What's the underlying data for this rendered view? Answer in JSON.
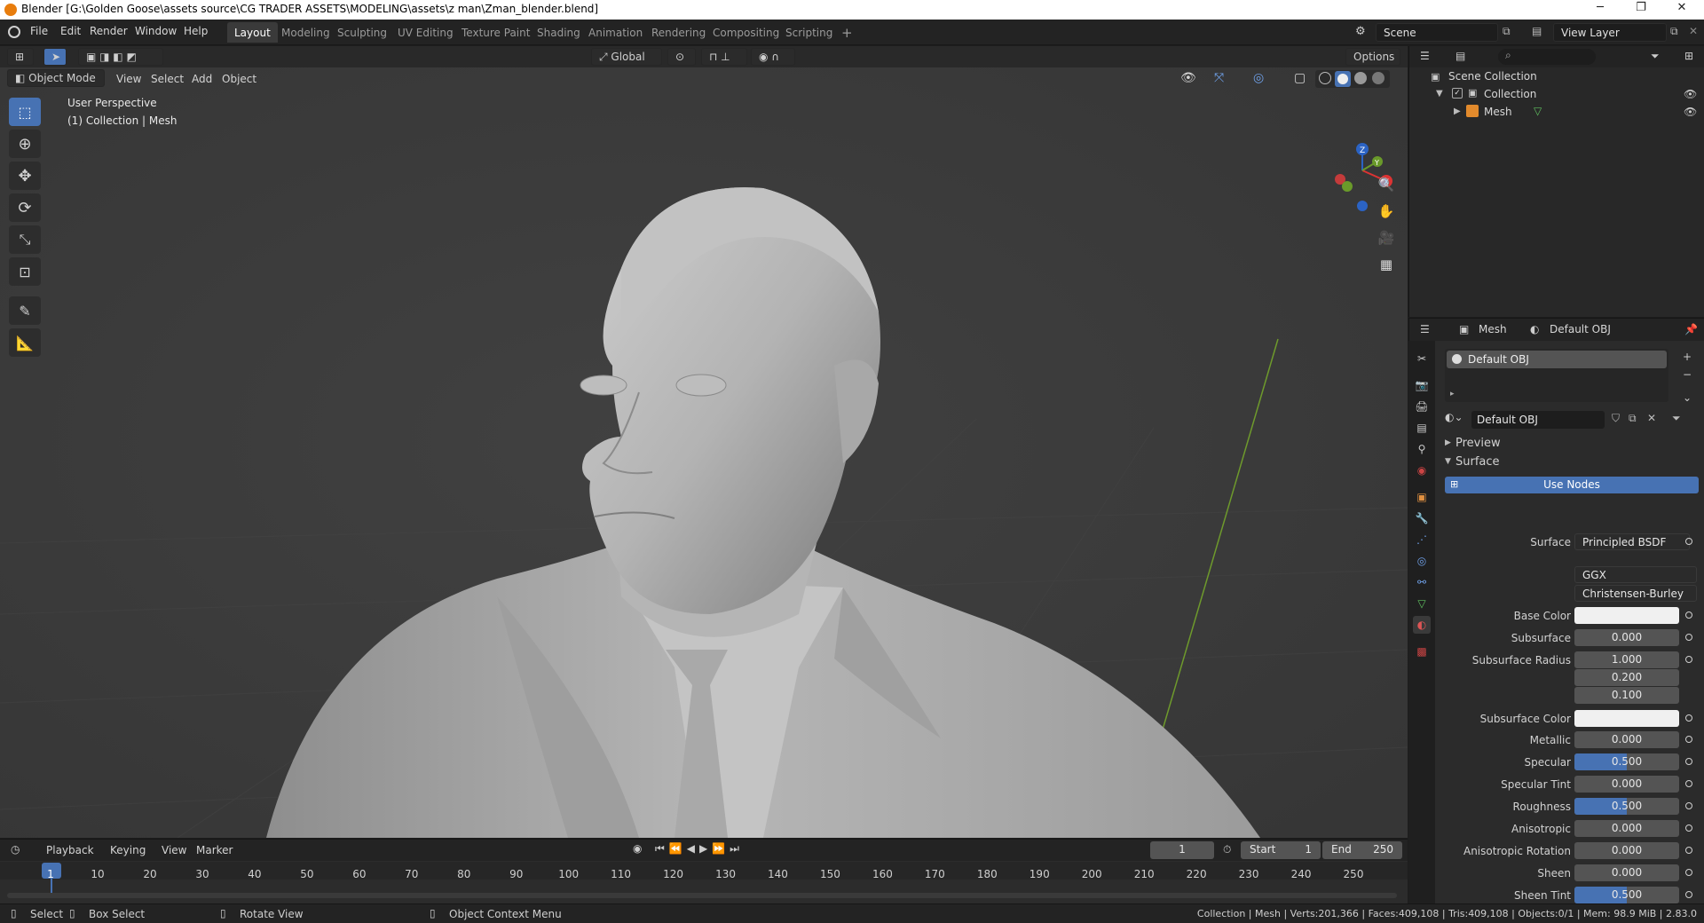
{
  "window": {
    "title": "Blender [G:\\Golden Goose\\assets source\\CG TRADER ASSETS\\MODELING\\assets\\z man\\Zman_blender.blend]",
    "controls": [
      "─",
      "❐",
      "✕"
    ]
  },
  "menu": [
    "File",
    "Edit",
    "Render",
    "Window",
    "Help"
  ],
  "workspaces": [
    "Layout",
    "Modeling",
    "Sculpting",
    "UV Editing",
    "Texture Paint",
    "Shading",
    "Animation",
    "Rendering",
    "Compositing",
    "Scripting"
  ],
  "workspace_add": "+",
  "active_workspace": "Layout",
  "scene": {
    "name": "Scene",
    "view_layer": "View Layer"
  },
  "toolbar_header": {
    "orientation": "Global",
    "options": "Options"
  },
  "viewport_header": {
    "mode": "Object Mode",
    "menus": [
      "View",
      "Select",
      "Add",
      "Object"
    ]
  },
  "viewport": {
    "perspective_label": "User Perspective",
    "collection_label": "(1) Collection | Mesh",
    "gizmo_axes": [
      "X",
      "Y",
      "Z"
    ]
  },
  "outliner": {
    "root": "Scene Collection",
    "collection": "Collection",
    "object": "Mesh"
  },
  "properties": {
    "breadcrumb": {
      "object": "Mesh",
      "material": "Default OBJ"
    },
    "material_slot": "Default OBJ",
    "material_name": "Default OBJ",
    "panels": {
      "preview": "Preview",
      "surface": "Surface"
    },
    "use_nodes": "Use Nodes",
    "surface_label": "Surface",
    "surface_shader": "Principled BSDF",
    "distribution": "GGX",
    "subsurface_method": "Christensen-Burley",
    "fields": [
      {
        "label": "Base Color",
        "value": "",
        "kind": "color",
        "color": "#f0f0f0"
      },
      {
        "label": "Subsurface",
        "value": "0.000",
        "kind": "num",
        "fill": 0
      },
      {
        "label": "Subsurface Radius",
        "value": "1.000",
        "kind": "num",
        "fill": 0
      },
      {
        "label": "",
        "value": "0.200",
        "kind": "num",
        "fill": 0
      },
      {
        "label": "",
        "value": "0.100",
        "kind": "num",
        "fill": 0
      },
      {
        "label": "Subsurface Color",
        "value": "",
        "kind": "color",
        "color": "#f0f0f0"
      },
      {
        "label": "Metallic",
        "value": "0.000",
        "kind": "num",
        "fill": 0
      },
      {
        "label": "Specular",
        "value": "0.500",
        "kind": "num",
        "fill": 0.5
      },
      {
        "label": "Specular Tint",
        "value": "0.000",
        "kind": "num",
        "fill": 0
      },
      {
        "label": "Roughness",
        "value": "0.500",
        "kind": "num",
        "fill": 0.5
      },
      {
        "label": "Anisotropic",
        "value": "0.000",
        "kind": "num",
        "fill": 0
      },
      {
        "label": "Anisotropic Rotation",
        "value": "0.000",
        "kind": "num",
        "fill": 0
      },
      {
        "label": "Sheen",
        "value": "0.000",
        "kind": "num",
        "fill": 0
      },
      {
        "label": "Sheen Tint",
        "value": "0.500",
        "kind": "num",
        "fill": 0.5
      }
    ]
  },
  "timeline": {
    "menus": [
      "Playback",
      "Keying",
      "View",
      "Marker"
    ],
    "current_frame": "1",
    "start_label": "Start",
    "start": "1",
    "end_label": "End",
    "end": "250",
    "ticks": [
      "1",
      "10",
      "20",
      "30",
      "40",
      "50",
      "60",
      "70",
      "80",
      "90",
      "100",
      "110",
      "120",
      "130",
      "140",
      "150",
      "160",
      "170",
      "180",
      "190",
      "200",
      "210",
      "220",
      "230",
      "240",
      "250"
    ]
  },
  "statusbar": {
    "select": "Select",
    "box_select": "Box Select",
    "rotate_view": "Rotate View",
    "context_menu": "Object Context Menu",
    "stats": "Collection | Mesh | Verts:201,366 | Faces:409,108 | Tris:409,108 | Objects:0/1 | Mem: 98.9 MiB | 2.83.0"
  },
  "colors": {
    "accent": "#4772b3",
    "viewport_bg": "#3c3c3c",
    "panel_bg": "#2b2b2b"
  }
}
